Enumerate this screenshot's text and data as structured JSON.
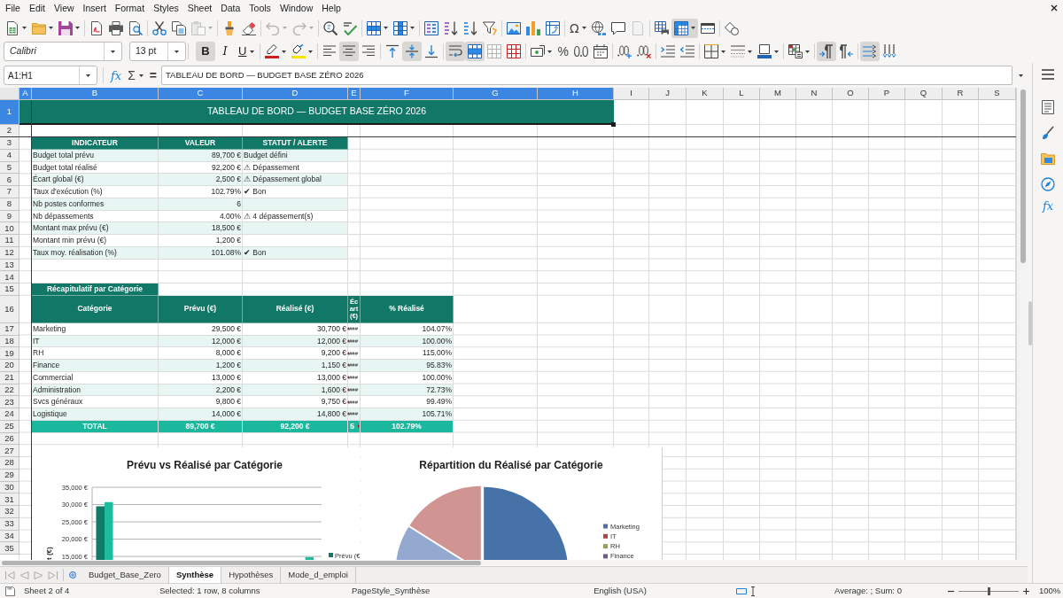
{
  "menu_bar": {
    "items": [
      "File",
      "Edit",
      "View",
      "Insert",
      "Format",
      "Styles",
      "Sheet",
      "Data",
      "Tools",
      "Window",
      "Help"
    ]
  },
  "standard_toolbar": {
    "paste_disabled": true,
    "undo_disabled": true,
    "redo_disabled": true,
    "header_footer_disabled": true,
    "special_character": "Ω",
    "freeze_rows_columns": true
  },
  "formatting_toolbar": {
    "font_name": "Calibri",
    "font_size": "13 pt",
    "bold": {
      "label": "B",
      "on": true
    },
    "italic": {
      "label": "I",
      "on": false
    },
    "underline": {
      "label": "U",
      "on": false
    },
    "align_left": false,
    "align_center": true,
    "align_right": false,
    "align_top": false,
    "align_middle": true,
    "align_bottom": false,
    "wrap_text": true,
    "merge_and_center": true,
    "merge_cells_disabled": true,
    "percent": "%",
    "paragraph_ltr": true,
    "paragraph_rtl": false,
    "text_ltr": true,
    "text_ttb": false
  },
  "formula_bar": {
    "name_box": "A1:H1",
    "function_wizard": "fx",
    "sum": "Σ",
    "formula": "=",
    "content": "TABLEAU DE BORD — BUDGET BASE ZÉRO 2026"
  },
  "sheet": {
    "columns": [
      {
        "label": "A",
        "selected": true
      },
      {
        "label": "B",
        "selected": true
      },
      {
        "label": "C",
        "selected": true
      },
      {
        "label": "D",
        "selected": true
      },
      {
        "label": "E",
        "selected": true
      },
      {
        "label": "F",
        "selected": true
      },
      {
        "label": "G",
        "selected": true
      },
      {
        "label": "H",
        "selected": true
      },
      {
        "label": "I",
        "selected": false
      },
      {
        "label": "J",
        "selected": false
      },
      {
        "label": "K",
        "selected": false
      },
      {
        "label": "L",
        "selected": false
      },
      {
        "label": "M",
        "selected": false
      },
      {
        "label": "N",
        "selected": false
      },
      {
        "label": "O",
        "selected": false
      },
      {
        "label": "P",
        "selected": false
      },
      {
        "label": "Q",
        "selected": false
      },
      {
        "label": "R",
        "selected": false
      },
      {
        "label": "S",
        "selected": false
      }
    ],
    "rows": [
      {
        "label": "1",
        "selected": true
      },
      {
        "label": "2",
        "selected": false
      },
      {
        "label": "3",
        "selected": false
      },
      {
        "label": "4",
        "selected": false
      },
      {
        "label": "5",
        "selected": false
      },
      {
        "label": "6",
        "selected": false
      },
      {
        "label": "7",
        "selected": false
      },
      {
        "label": "8",
        "selected": false
      },
      {
        "label": "9",
        "selected": false
      },
      {
        "label": "10",
        "selected": false
      },
      {
        "label": "11",
        "selected": false
      },
      {
        "label": "12",
        "selected": false
      },
      {
        "label": "13",
        "selected": false
      },
      {
        "label": "14",
        "selected": false
      },
      {
        "label": "15",
        "selected": false
      },
      {
        "label": "16",
        "selected": false
      },
      {
        "label": "17",
        "selected": false
      },
      {
        "label": "18",
        "selected": false
      },
      {
        "label": "19",
        "selected": false
      },
      {
        "label": "20",
        "selected": false
      },
      {
        "label": "21",
        "selected": false
      },
      {
        "label": "22",
        "selected": false
      },
      {
        "label": "23",
        "selected": false
      },
      {
        "label": "24",
        "selected": false
      },
      {
        "label": "25",
        "selected": false
      },
      {
        "label": "26",
        "selected": false
      },
      {
        "label": "27",
        "selected": false
      },
      {
        "label": "28",
        "selected": false
      },
      {
        "label": "29",
        "selected": false
      },
      {
        "label": "30",
        "selected": false
      },
      {
        "label": "31",
        "selected": false
      },
      {
        "label": "32",
        "selected": false
      },
      {
        "label": "33",
        "selected": false
      },
      {
        "label": "34",
        "selected": false
      },
      {
        "label": "35",
        "selected": false
      }
    ],
    "title": "TABLEAU DE BORD — BUDGET BASE ZÉRO 2026",
    "indicators": {
      "headers": [
        "INDICATEUR",
        "VALEUR",
        "STATUT / ALERTE"
      ],
      "rows": [
        {
          "indicator": "Budget total prévu",
          "value": "89,700 €",
          "status": "Budget défini"
        },
        {
          "indicator": "Budget total réalisé",
          "value": "92,200 €",
          "status": "⚠ Dépassement"
        },
        {
          "indicator": "Écart global (€)",
          "value": "2,500 €",
          "status": "⚠ Dépassement global"
        },
        {
          "indicator": "Taux d'exécution (%)",
          "value": "102.79%",
          "status": "✔ Bon"
        },
        {
          "indicator": "Nb postes conformes",
          "value": "6"
        },
        {
          "indicator": "Nb dépassements",
          "value": "4.00%",
          "status": "⚠ 4 dépassement(s)"
        },
        {
          "indicator": "Montant max prévu (€)",
          "value": "18,500 €"
        },
        {
          "indicator": "Montant min prévu (€)",
          "value": "1,200 €"
        },
        {
          "indicator": "Taux moy. réalisation (%)",
          "value": "101.08%",
          "status": "✔ Bon"
        }
      ]
    },
    "summary": {
      "title": "Récapitulatif par Catégorie",
      "headers": [
        "Catégorie",
        "Prévu (€)",
        "Réalisé (€)",
        "Écart (€)",
        "% Réalisé"
      ],
      "rows": [
        {
          "category": "Marketing",
          "planned": "29,500 €",
          "actual": "30,700 €",
          "variance": "###",
          "overflow": true,
          "percent": "104.07%"
        },
        {
          "category": "IT",
          "planned": "12,000 €",
          "actual": "12,000 €",
          "variance": "###",
          "overflow": true,
          "percent": "100.00%"
        },
        {
          "category": "RH",
          "planned": "8,000 €",
          "actual": "9,200 €",
          "variance": "###",
          "overflow": true,
          "percent": "115.00%"
        },
        {
          "category": "Finance",
          "planned": "1,200 €",
          "actual": "1,150 €",
          "variance": "###",
          "overflow": true,
          "percent": "95.83%"
        },
        {
          "category": "Commercial",
          "planned": "13,000 €",
          "actual": "13,000 €",
          "variance": "###",
          "overflow": true,
          "percent": "100.00%"
        },
        {
          "category": "Administration",
          "planned": "2,200 €",
          "actual": "1,600 €",
          "variance": "###",
          "overflow": true,
          "percent": "72.73%"
        },
        {
          "category": "Svcs généraux",
          "planned": "9,800 €",
          "actual": "9,750 €",
          "variance": "###",
          "overflow": true,
          "percent": "99.49%"
        },
        {
          "category": "Logistique",
          "planned": "14,000 €",
          "actual": "14,800 €",
          "variance": "###",
          "overflow": true,
          "percent": "105.71%"
        }
      ],
      "total": {
        "label": "TOTAL",
        "planned": "89,700 €",
        "actual": "92,200 €",
        "variance": "5",
        "overflow": true,
        "percent": "102.79%"
      }
    },
    "bar_chart": {
      "chart_data": {
        "type": "bar",
        "title": "Prévu vs Réalisé par Catégorie",
        "ylabel": "t (€)",
        "stacked": false,
        "grid": true,
        "series": [
          {
            "name": "Prévu (€",
            "color": "#127a68",
            "values": [
              29500,
              null,
              null,
              null,
              null,
              null,
              null,
              14000
            ]
          },
          {
            "color": "#1dbc9f",
            "values": [
              30700,
              null,
              null,
              null,
              null,
              null,
              null,
              14800
            ]
          }
        ],
        "ylim": [
          14000,
          35000
        ],
        "yticks": [
          {
            "value": 15000,
            "label": "15,000 €"
          },
          {
            "value": 20000,
            "label": "20,000 €"
          },
          {
            "value": 25000,
            "label": "25,000 €"
          },
          {
            "value": 30000,
            "label": "30,000 €"
          },
          {
            "value": 35000,
            "label": "35,000 €"
          }
        ]
      }
    },
    "pie_chart": {
      "title": "Répartition du Réalisé par Catégorie",
      "legend": [
        {
          "label": "Marketing",
          "color": "#4672a8"
        },
        {
          "label": "IT",
          "color": "#aa4643"
        },
        {
          "label": "RH",
          "color": "#89a54e"
        },
        {
          "label": "Finance",
          "color": "#71588f"
        }
      ]
    }
  },
  "sidebar": {
    "functions": "fx"
  },
  "sheet_tabs": {
    "tabs": [
      {
        "label": "Budget_Base_Zero",
        "selected": false
      },
      {
        "label": "Synthèse",
        "selected": true
      },
      {
        "label": "Hypothèses",
        "selected": false
      },
      {
        "label": "Mode_d_emploi",
        "selected": false
      }
    ]
  },
  "status_bar": {
    "sheet": "Sheet 2 of 4",
    "selection": "Selected: 1 row, 8 columns",
    "page_style": "PageStyle_Synthèse",
    "language": "English (USA)",
    "summary": "Average: ; Sum: 0",
    "zoom": {
      "level": 0.5,
      "reading": "100%"
    }
  }
}
